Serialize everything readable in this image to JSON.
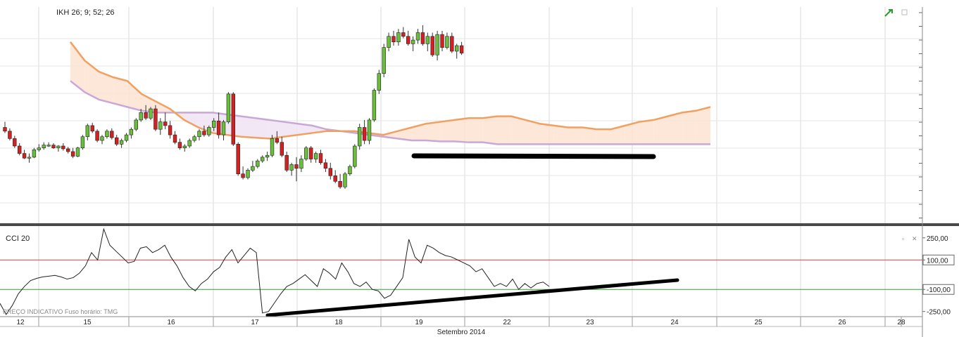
{
  "chart_data": [
    {
      "type": "candlestick",
      "legend": "IKH 26; 9; 52; 26",
      "up_color": "#6abf3a",
      "down_color": "#d42020",
      "grid": true,
      "cloud_colors": {
        "tenkan": "#f0a060",
        "kijun": "#c9a8d8",
        "cloud_up": "#fbe3d2",
        "cloud_down": "#efe3f3"
      },
      "candles": [
        [
          88,
          94,
          82,
          84
        ],
        [
          84,
          87,
          74,
          76
        ],
        [
          76,
          79,
          66,
          68
        ],
        [
          68,
          71,
          58,
          60
        ],
        [
          60,
          64,
          54,
          55
        ],
        [
          55,
          60,
          50,
          56
        ],
        [
          56,
          66,
          55,
          64
        ],
        [
          64,
          70,
          62,
          66
        ],
        [
          66,
          72,
          64,
          69
        ],
        [
          69,
          72,
          67,
          69
        ],
        [
          69,
          71,
          65,
          66
        ],
        [
          66,
          69,
          62,
          68
        ],
        [
          68,
          71,
          63,
          65
        ],
        [
          65,
          67,
          60,
          62
        ],
        [
          62,
          66,
          55,
          57
        ],
        [
          57,
          67,
          56,
          66
        ],
        [
          66,
          80,
          64,
          78
        ],
        [
          78,
          92,
          74,
          90
        ],
        [
          90,
          93,
          82,
          84
        ],
        [
          84,
          86,
          72,
          74
        ],
        [
          74,
          80,
          70,
          78
        ],
        [
          78,
          86,
          76,
          84
        ],
        [
          84,
          87,
          75,
          77
        ],
        [
          77,
          80,
          68,
          70
        ],
        [
          70,
          76,
          66,
          74
        ],
        [
          74,
          82,
          72,
          80
        ],
        [
          80,
          88,
          76,
          86
        ],
        [
          86,
          98,
          84,
          96
        ],
        [
          96,
          108,
          94,
          104
        ],
        [
          104,
          112,
          96,
          98
        ],
        [
          98,
          110,
          96,
          108
        ],
        [
          108,
          112,
          84,
          86
        ],
        [
          86,
          98,
          80,
          94
        ],
        [
          94,
          104,
          86,
          90
        ],
        [
          90,
          95,
          76,
          80
        ],
        [
          80,
          84,
          70,
          72
        ],
        [
          72,
          76,
          64,
          66
        ],
        [
          66,
          70,
          62,
          68
        ],
        [
          68,
          76,
          66,
          74
        ],
        [
          74,
          80,
          72,
          78
        ],
        [
          78,
          86,
          74,
          84
        ],
        [
          84,
          90,
          78,
          80
        ],
        [
          80,
          90,
          78,
          88
        ],
        [
          88,
          98,
          84,
          95
        ],
        [
          95,
          104,
          76,
          80
        ],
        [
          80,
          96,
          74,
          94
        ],
        [
          94,
          126,
          92,
          124
        ],
        [
          124,
          126,
          68,
          70
        ],
        [
          70,
          72,
          36,
          38
        ],
        [
          38,
          46,
          32,
          34
        ],
        [
          34,
          44,
          32,
          42
        ],
        [
          42,
          52,
          40,
          46
        ],
        [
          46,
          54,
          44,
          52
        ],
        [
          52,
          58,
          50,
          56
        ],
        [
          56,
          62,
          52,
          58
        ],
        [
          58,
          80,
          56,
          76
        ],
        [
          76,
          84,
          70,
          72
        ],
        [
          72,
          78,
          56,
          58
        ],
        [
          58,
          62,
          40,
          42
        ],
        [
          42,
          50,
          36,
          48
        ],
        [
          48,
          56,
          30,
          44
        ],
        [
          44,
          58,
          40,
          54
        ],
        [
          54,
          68,
          52,
          66
        ],
        [
          66,
          68,
          50,
          54
        ],
        [
          54,
          62,
          50,
          60
        ],
        [
          60,
          64,
          48,
          50
        ],
        [
          50,
          54,
          40,
          44
        ],
        [
          44,
          50,
          32,
          36
        ],
        [
          36,
          42,
          28,
          30
        ],
        [
          30,
          38,
          22,
          24
        ],
        [
          24,
          40,
          22,
          38
        ],
        [
          38,
          48,
          36,
          46
        ],
        [
          46,
          70,
          44,
          68
        ],
        [
          68,
          92,
          64,
          88
        ],
        [
          88,
          96,
          70,
          74
        ],
        [
          74,
          98,
          70,
          96
        ],
        [
          96,
          130,
          94,
          128
        ],
        [
          128,
          150,
          124,
          146
        ],
        [
          146,
          178,
          142,
          174
        ],
        [
          174,
          190,
          170,
          186
        ],
        [
          186,
          192,
          176,
          180
        ],
        [
          180,
          194,
          176,
          190
        ],
        [
          190,
          196,
          184,
          186
        ],
        [
          186,
          192,
          176,
          178
        ],
        [
          178,
          186,
          170,
          182
        ],
        [
          182,
          194,
          178,
          190
        ],
        [
          190,
          198,
          176,
          178
        ],
        [
          178,
          190,
          170,
          186
        ],
        [
          186,
          190,
          164,
          166
        ],
        [
          166,
          192,
          160,
          188
        ],
        [
          188,
          192,
          170,
          174
        ],
        [
          174,
          190,
          172,
          186
        ],
        [
          186,
          190,
          168,
          170
        ],
        [
          170,
          178,
          162,
          176
        ],
        [
          176,
          180,
          166,
          168
        ]
      ],
      "tenkan": [
        180,
        160,
        148,
        142,
        138,
        124,
        116,
        108,
        96,
        88,
        82,
        80,
        78,
        77,
        76,
        78,
        80,
        82,
        84,
        84,
        84,
        82,
        80,
        84,
        88,
        92,
        94,
        96,
        98,
        98,
        100,
        100,
        96,
        92,
        90,
        88,
        88,
        86,
        86,
        90,
        94,
        96,
        100,
        104,
        106,
        110
      ],
      "kijun": [
        138,
        126,
        118,
        114,
        110,
        106,
        104,
        104,
        104,
        104,
        104,
        102,
        100,
        98,
        96,
        94,
        92,
        90,
        86,
        84,
        82,
        80,
        78,
        76,
        74,
        74,
        73,
        73,
        72,
        72,
        70,
        70,
        70,
        70,
        70,
        70,
        70,
        70,
        70,
        70,
        70,
        70,
        70,
        70,
        70,
        70
      ],
      "cci": {
        "label": "CCI 20",
        "levels": [
          250,
          100,
          -100,
          -250
        ],
        "level_labels": [
          "250,00",
          "100,00",
          "-100,00",
          "-250,00"
        ],
        "overbought_color": "#d84040",
        "oversold_color": "#3a9a3a",
        "values": [
          -195,
          -270,
          -210,
          -130,
          -80,
          -40,
          -25,
          -15,
          -10,
          -5,
          -15,
          -30,
          -20,
          10,
          60,
          150,
          100,
          310,
          200,
          160,
          120,
          80,
          90,
          180,
          190,
          150,
          170,
          200,
          120,
          60,
          -20,
          -80,
          -110,
          -60,
          -30,
          20,
          50,
          120,
          170,
          80,
          130,
          180,
          150,
          -260,
          -250,
          -190,
          -130,
          -80,
          -60,
          -30,
          0,
          -40,
          -80,
          40,
          10,
          -30,
          80,
          20,
          -60,
          -80,
          -50,
          -100,
          -110,
          -160,
          -140,
          -80,
          -20,
          240,
          120,
          80,
          200,
          180,
          150,
          130,
          120,
          100,
          80,
          60,
          20,
          40,
          -20,
          -80,
          -60,
          -80,
          -30,
          -100,
          -60,
          -90,
          -60,
          -50,
          -80
        ]
      },
      "x_tick_labels": [
        "12",
        "15",
        "16",
        "17",
        "18",
        "19",
        "22",
        "23",
        "24",
        "25",
        "26",
        "28"
      ],
      "x_axis_title": "Setembro 2014",
      "footer": "PREÇO INDICATIVO   Fuso horário: TMG"
    }
  ]
}
